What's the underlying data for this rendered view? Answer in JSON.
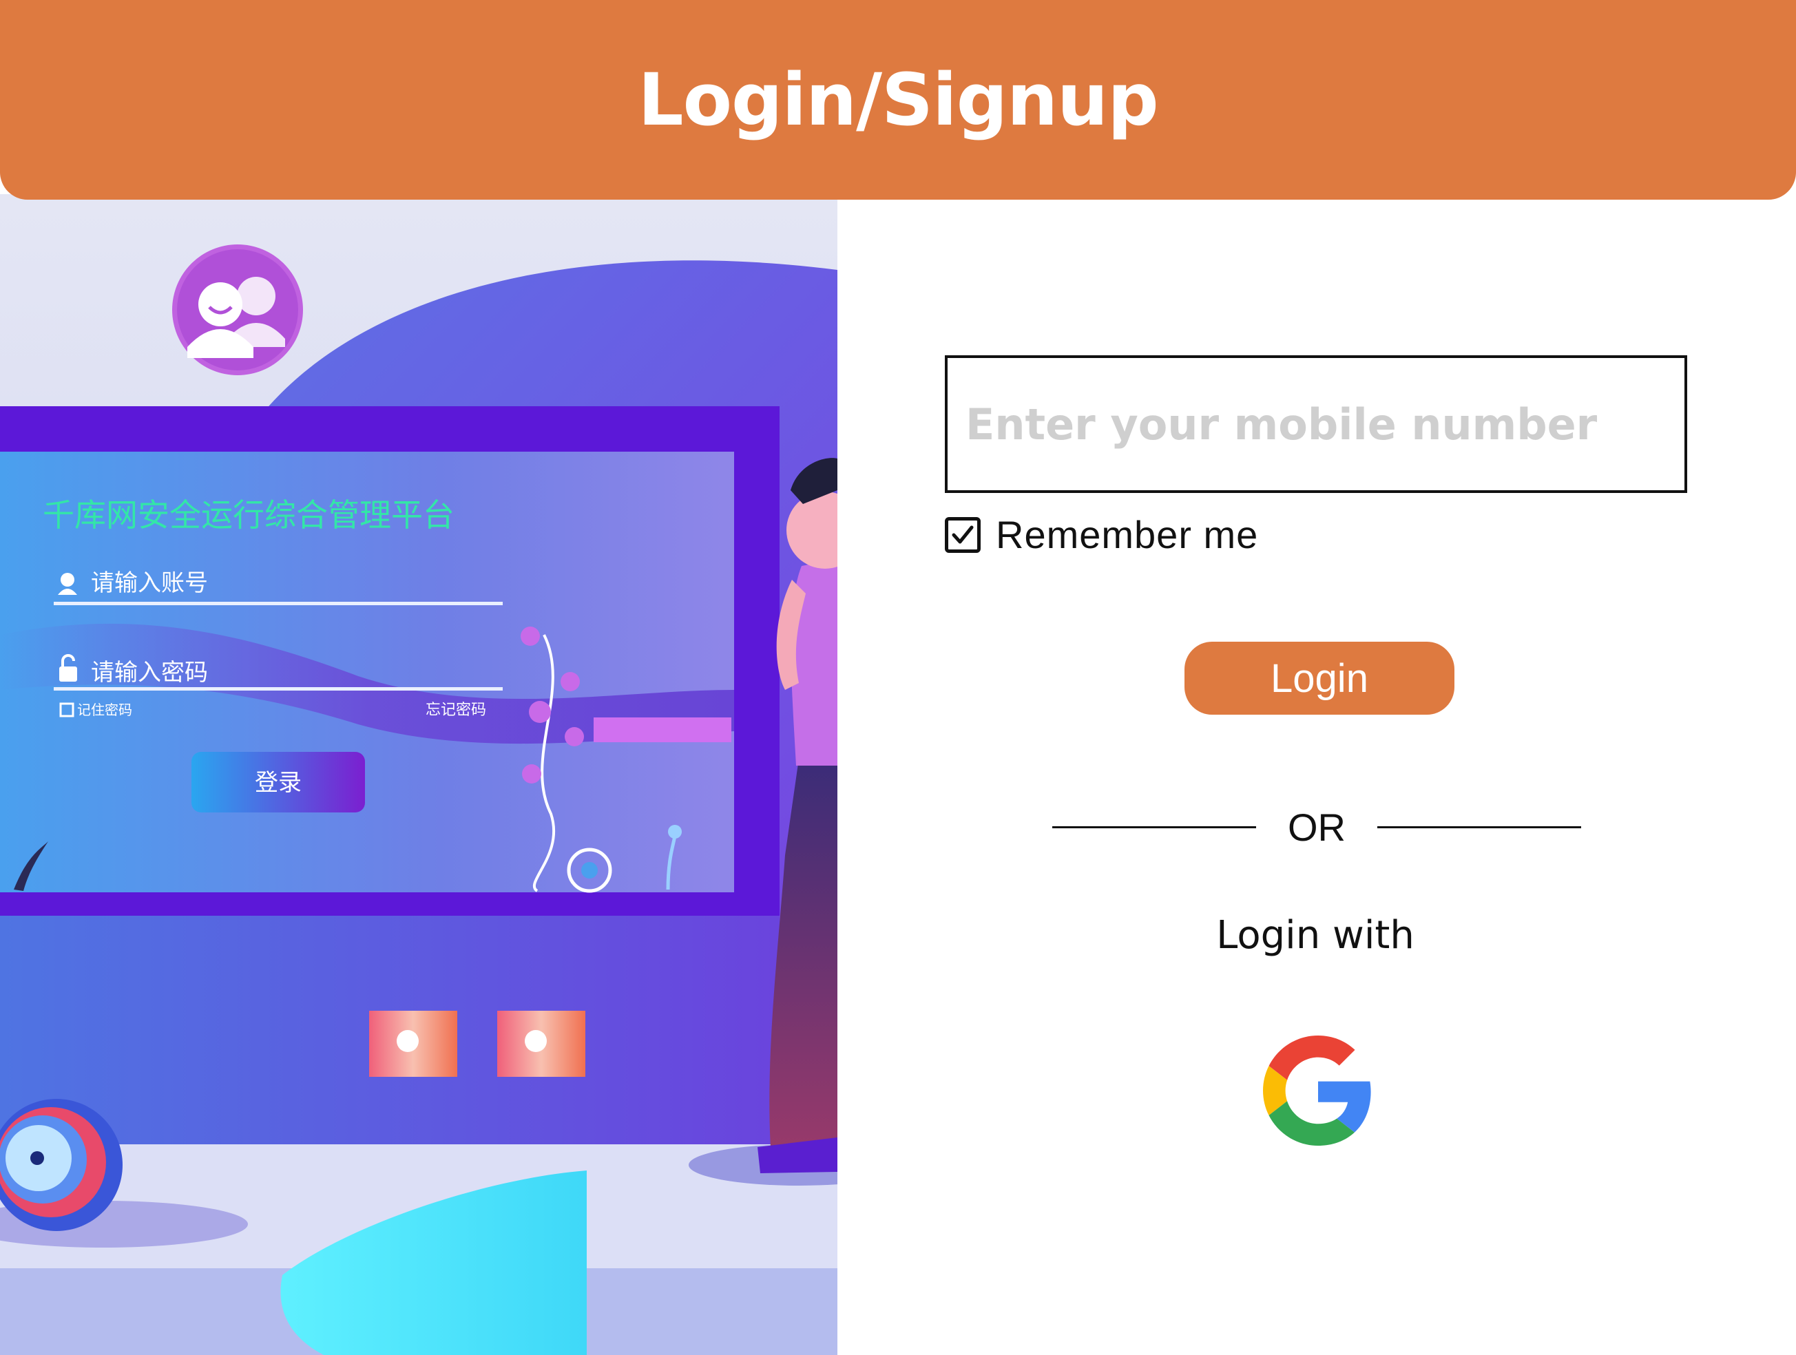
{
  "header": {
    "title": "Login/Signup",
    "background_color": "#DE7A40"
  },
  "illustration": {
    "description_icon": "people-icon",
    "screen_title": "千库网安全运行综合管理平台",
    "username_placeholder": "请输入账号",
    "password_placeholder": "请输入密码",
    "remember_password": "记住密码",
    "forgot_password": "忘记密码",
    "login_button": "登录"
  },
  "form": {
    "mobile_placeholder": "Enter your mobile number",
    "mobile_value": "",
    "remember_label": "Remember me",
    "remember_checked": true,
    "login_label": "Login",
    "or_label": "OR",
    "login_with_label": "Login with",
    "social_icon": "google-icon"
  },
  "colors": {
    "accent": "#DE7A40",
    "text": "#111111",
    "placeholder": "#cfcfcf"
  }
}
